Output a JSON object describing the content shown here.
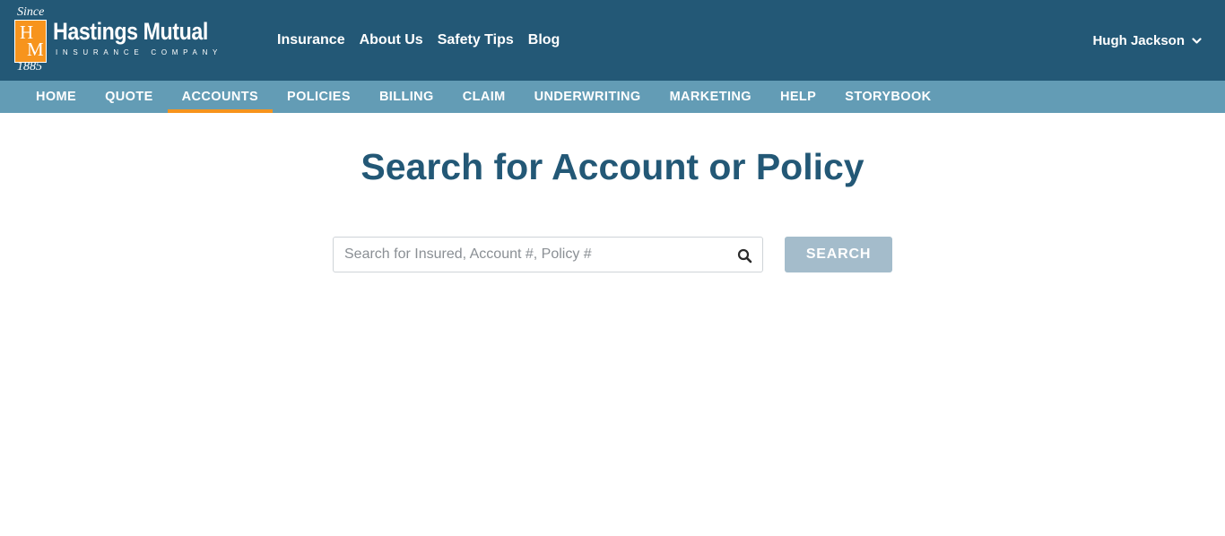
{
  "header": {
    "logo": {
      "since": "Since",
      "year": "1885",
      "mark_top": "H",
      "mark_bottom": "M",
      "name": "Hastings Mutual",
      "subtitle": "INSURANCE COMPANY"
    },
    "nav": [
      "Insurance",
      "About Us",
      "Safety Tips",
      "Blog"
    ],
    "user": {
      "name": "Hugh Jackson",
      "icon": "chevron-down-icon"
    }
  },
  "subnav": {
    "tabs": [
      "HOME",
      "QUOTE",
      "ACCOUNTS",
      "POLICIES",
      "BILLING",
      "CLAIM",
      "UNDERWRITING",
      "MARKETING",
      "HELP",
      "STORYBOOK"
    ],
    "active_tab": "ACCOUNTS"
  },
  "main": {
    "title": "Search for Account or Policy",
    "search": {
      "placeholder": "Search for Insured, Account #, Policy #",
      "value": "",
      "icon": "search-icon"
    },
    "search_button": "SEARCH"
  },
  "colors": {
    "header_bg": "#235876",
    "subnav_bg": "#639cb5",
    "accent": "#f7941d",
    "title": "#235876",
    "button_bg": "#a4bccb"
  }
}
